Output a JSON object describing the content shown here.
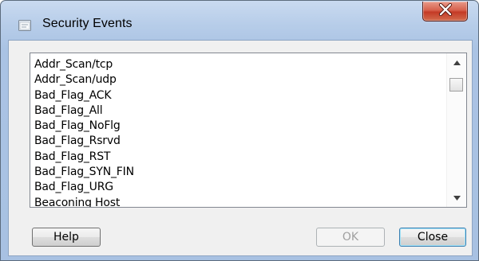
{
  "window": {
    "title": "Security Events",
    "icon": "window-icon",
    "close_icon": "close-x-icon"
  },
  "list": {
    "items": [
      "Addr_Scan/tcp",
      "Addr_Scan/udp",
      "Bad_Flag_ACK",
      "Bad_Flag_All",
      "Bad_Flag_NoFlg",
      "Bad_Flag_Rsrvd",
      "Bad_Flag_RST",
      "Bad_Flag_SYN_FIN",
      "Bad_Flag_URG",
      "Beaconing Host"
    ],
    "scroll_up_icon": "scroll-up-arrow-icon",
    "scroll_down_icon": "scroll-down-arrow-icon"
  },
  "buttons": {
    "help_label": "Help",
    "ok_label": "OK",
    "close_label": "Close"
  },
  "colors": {
    "title_gradient_top": "#c9daf0",
    "client_bg": "#f0f0f0",
    "close_button_red": "#c43a26"
  }
}
